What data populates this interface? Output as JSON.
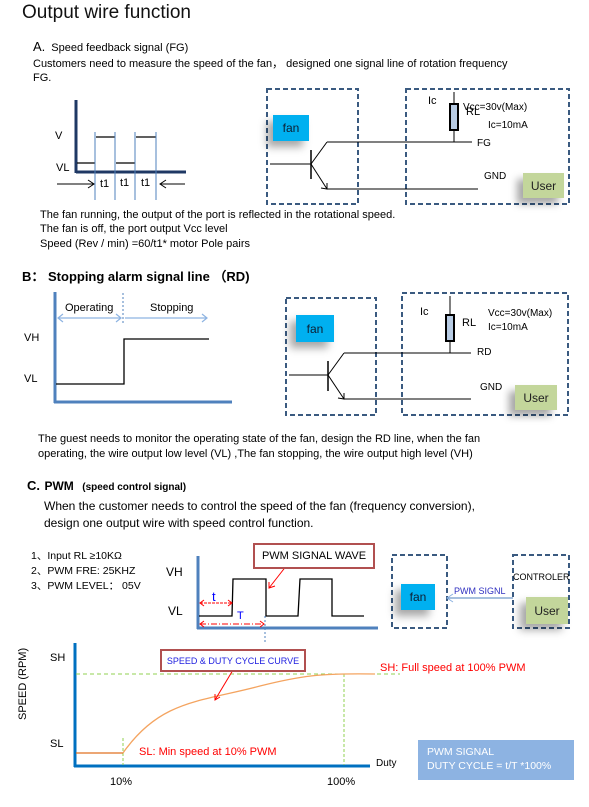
{
  "page": {
    "title": "Output wire function"
  },
  "section_a": {
    "letter": "A.",
    "heading": "Speed feedback signal (FG)",
    "intro_line1": "Customers need to measure the speed of the fan， designed one signal line of rotation frequency",
    "intro_line2": "FG.",
    "waveform": {
      "label_v": "V",
      "label_vl": "VL",
      "period_labels": [
        "t1",
        "t1",
        "t1"
      ]
    },
    "circuit": {
      "fan_label": "fan",
      "user_label": "User",
      "ic_label": "Ic",
      "rl_label": "RL",
      "vcc_label": "Vcc=30v(Max)",
      "ic_value": "Ic=10mA",
      "signal_label": "FG",
      "gnd_label": "GND"
    },
    "notes": [
      "The fan running, the output of the port is reflected in the rotational speed.",
      "The fan is off, the port output  Vcc level",
      "Speed (Rev / min) =60/t1* motor Pole pairs"
    ]
  },
  "section_b": {
    "heading": "B： Stopping alarm signal line （RD)",
    "waveform": {
      "label_vh": "VH",
      "label_vl": "VL",
      "phase_operating": "Operating",
      "phase_stopping": "Stopping"
    },
    "circuit": {
      "fan_label": "fan",
      "user_label": "User",
      "ic_label": "Ic",
      "rl_label": "RL",
      "vcc_label": "Vcc=30v(Max)",
      "ic_value": "Ic=10mA",
      "signal_label": "RD",
      "gnd_label": "GND"
    },
    "notes": [
      "The guest needs to monitor the operating state of the fan,  design the RD line, when the fan",
      "operating, the wire output low level (VL) ,The fan stopping, the wire output high level (VH)"
    ]
  },
  "section_c": {
    "letter": "C.",
    "heading": "PWM",
    "subheading": "(speed control signal)",
    "intro": [
      "When the customer needs to control the speed of the fan (frequency conversion),",
      "design one output wire with  speed control function."
    ],
    "specs": [
      "1、Input RL ≥10KΩ",
      "2、PWM FRE: 25KHZ",
      "3、PWM LEVEL： 05V"
    ],
    "waveform": {
      "label_vh": "VH",
      "label_vl": "VL",
      "label_t": "t",
      "label_T": "T",
      "callout": "PWM SIGNAL WAVE"
    },
    "controller": {
      "fan_label": "fan",
      "controller_label": "CONTROLER",
      "user_label": "User",
      "signal_label": "PWM SIGNL"
    },
    "curve": {
      "ylabel": "SPEED (RPM)",
      "label_sh": "SH",
      "label_sl": "SL",
      "xlabel": "Duty",
      "tick_10": "10%",
      "tick_100": "100%",
      "callout": "SPEED & DUTY CYCLE CURVE",
      "annotation_sh": "SH: Full speed at 100% PWM",
      "annotation_sl": "SL: Min speed at 10% PWM"
    },
    "formula": {
      "line1": "PWM SIGNAL",
      "line2": "DUTY CYCLE =  t/T *100%"
    }
  },
  "colors": {
    "fan_box": "#00b0f0",
    "user_box": "#c3d69b",
    "dashed_border": "#3a5a80",
    "axis_blue": "#4f81bd",
    "curve_orange": "#f0a060",
    "guide_green": "#92d050",
    "annotation_red": "#ff0000",
    "callout_border": "#b15050",
    "formula_bg": "#8db3e2"
  }
}
